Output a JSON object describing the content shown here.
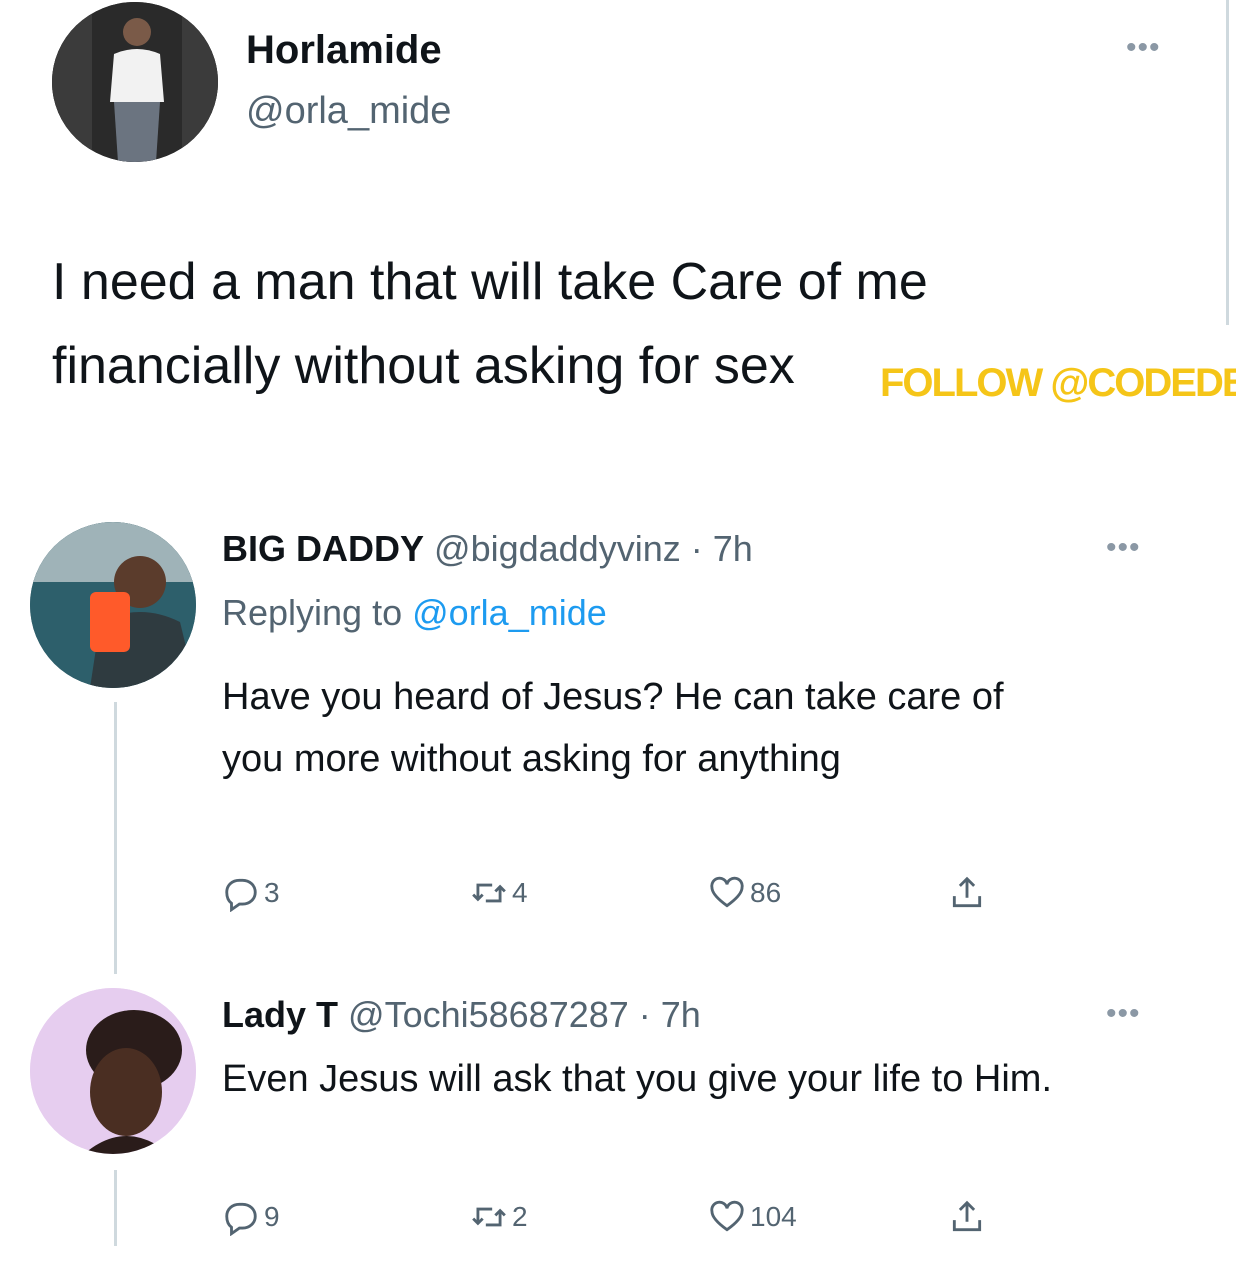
{
  "main_tweet": {
    "display_name": "Horlamide",
    "handle": "@orla_mide",
    "text": "I need a man that will take Care of me financially without asking for sex"
  },
  "watermark": {
    "text": "FOLLOW @CODEDB",
    "color": "#f5c518"
  },
  "replies": [
    {
      "display_name": "BIG DADDY",
      "handle_time": "@bigdaddyvinz · 7h",
      "replying_prefix": "Replying to",
      "replying_handle": "@orla_mide",
      "text": "Have you heard of Jesus? He can take care of you more without asking for anything",
      "reply_count": "3",
      "retweet_count": "4",
      "like_count": "86"
    },
    {
      "display_name": "Lady T",
      "handle_time": "@Tochi58687287 · 7h",
      "text": "Even Jesus will ask that you give your life to Him.",
      "reply_count": "9",
      "retweet_count": "2",
      "like_count": "104"
    }
  ],
  "icons": {
    "more": "more-dots-icon",
    "reply": "reply-icon",
    "retweet": "retweet-icon",
    "like": "heart-icon",
    "share": "share-icon"
  },
  "colors": {
    "link": "#1d9bf0",
    "muted": "#536471",
    "thread_line": "#cfd9de"
  }
}
